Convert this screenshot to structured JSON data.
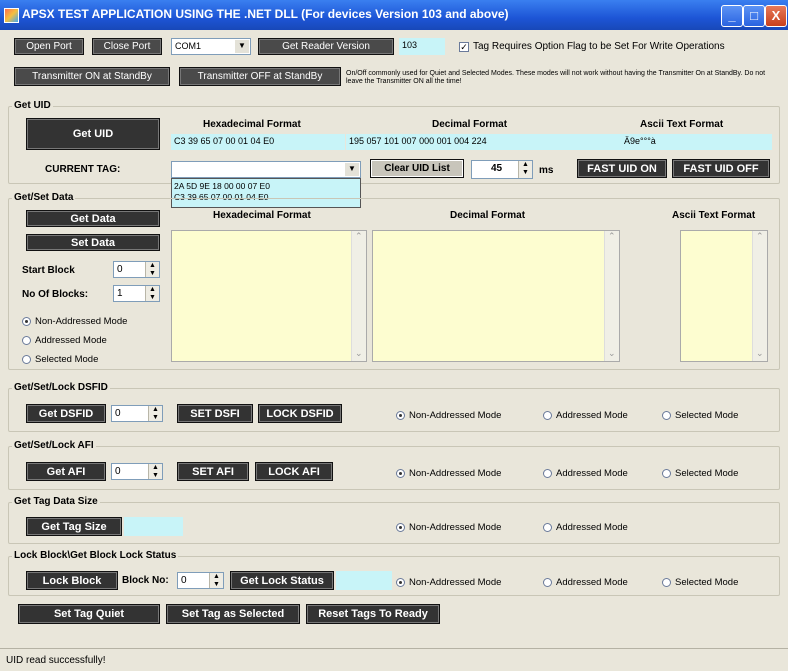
{
  "window": {
    "title": "APSX TEST APPLICATION USING THE .NET DLL (For devices Version 103 and above)",
    "min": "_",
    "max": "□",
    "close": "X"
  },
  "toolbar": {
    "open_port": "Open Port",
    "close_port": "Close Port",
    "port": "COM1",
    "get_reader_version": "Get Reader Version",
    "version": "103",
    "option_flag_label": "Tag Requires Option Flag to be Set For Write Operations",
    "tx_on": "Transmitter ON at StandBy",
    "tx_off": "Transmitter OFF at StandBy",
    "tx_note": "On/Off commonly used for Quiet and Selected Modes. These modes will not work without having the Transmitter On at StandBy. Do not leave the Transmitter ON all the time!"
  },
  "get_uid": {
    "title": "Get UID",
    "button": "Get UID",
    "hex_header": "Hexadecimal Format",
    "dec_header": "Decimal Format",
    "ascii_header": "Ascii Text Format",
    "hex_value": "C3 39 65 07 00 01 04 E0",
    "dec_value": "195 057 101 007 000 001 004 224",
    "ascii_value": "Ä9e°°°à",
    "current_tag_label": "CURRENT TAG:",
    "current_tag_value": "",
    "tag_options": [
      "2A 5D 9E 18 00 00 07 E0",
      "C3 39 65 07 00 01 04 E0"
    ],
    "clear_uid": "Clear UID List",
    "interval": "45",
    "interval_unit": "ms",
    "fast_on": "FAST UID ON",
    "fast_off": "FAST UID OFF"
  },
  "data": {
    "title": "Get/Set Data",
    "get": "Get Data",
    "set": "Set Data",
    "hex_header": "Hexadecimal Format",
    "dec_header": "Decimal Format",
    "ascii_header": "Ascii Text Format",
    "start_block_label": "Start Block",
    "start_block": "0",
    "num_blocks_label": "No Of Blocks:",
    "num_blocks": "1",
    "modes": [
      "Non-Addressed Mode",
      "Addressed Mode",
      "Selected Mode"
    ]
  },
  "dsfid": {
    "title": "Get/Set/Lock DSFID",
    "get": "Get DSFID",
    "value": "0",
    "set": "SET DSFI",
    "lock": "LOCK DSFID",
    "modes": [
      "Non-Addressed Mode",
      "Addressed Mode",
      "Selected Mode"
    ]
  },
  "afi": {
    "title": "Get/Set/Lock AFI",
    "get": "Get AFI",
    "value": "0",
    "set": "SET AFI",
    "lock": "LOCK AFI",
    "modes": [
      "Non-Addressed Mode",
      "Addressed Mode",
      "Selected Mode"
    ]
  },
  "size": {
    "title": "Get Tag Data Size",
    "get": "Get Tag Size",
    "value": "",
    "modes": [
      "Non-Addressed Mode",
      "Addressed Mode"
    ]
  },
  "lock": {
    "title": "Lock Block\\Get Block Lock Status",
    "lock": "Lock Block",
    "block_label": "Block No:",
    "block": "0",
    "status": "Get Lock Status",
    "value": "",
    "modes": [
      "Non-Addressed Mode",
      "Addressed Mode",
      "Selected Mode"
    ]
  },
  "bottom": {
    "quiet": "Set Tag Quiet",
    "selected": "Set Tag as Selected",
    "reset": "Reset Tags To Ready"
  },
  "status": "UID read successfully!"
}
